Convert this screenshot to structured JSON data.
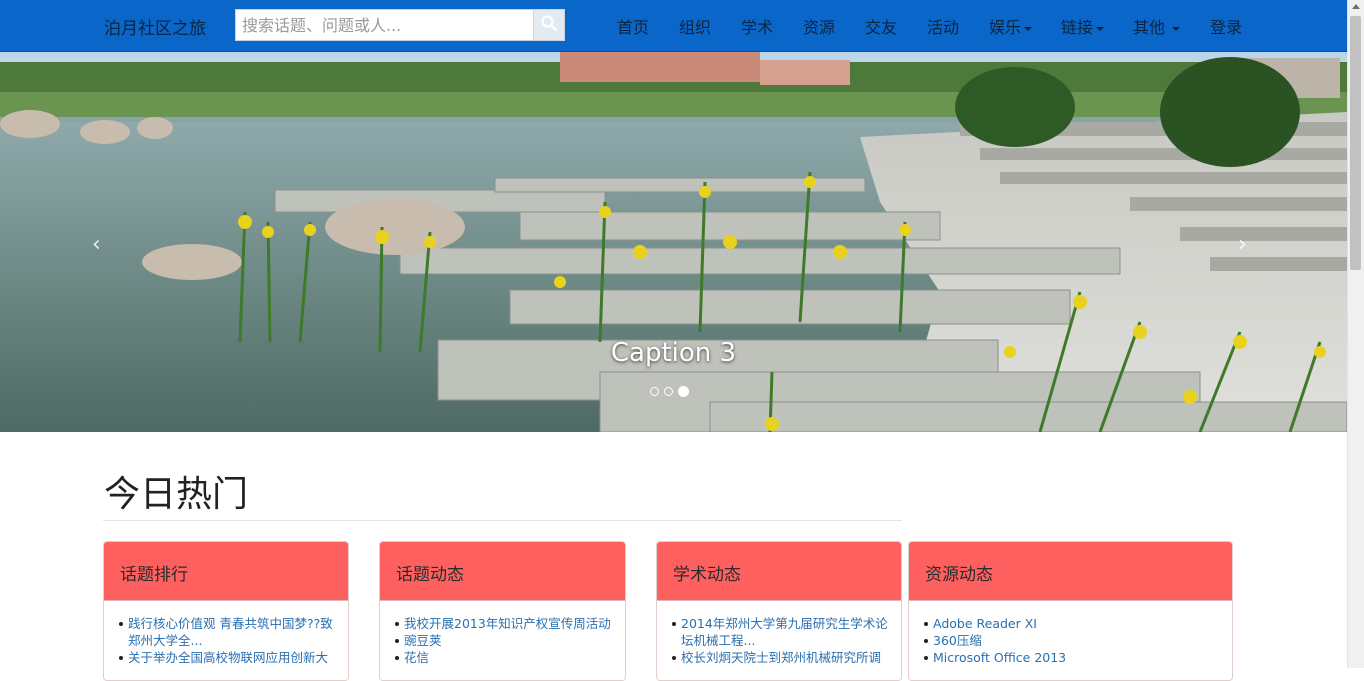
{
  "navbar": {
    "brand": "泊月社区之旅",
    "search_placeholder": "搜索话题、问题或人...",
    "items": [
      {
        "label": "首页",
        "dropdown": false
      },
      {
        "label": "组织",
        "dropdown": false
      },
      {
        "label": "学术",
        "dropdown": false
      },
      {
        "label": "资源",
        "dropdown": false
      },
      {
        "label": "交友",
        "dropdown": false
      },
      {
        "label": "活动",
        "dropdown": false
      },
      {
        "label": "娱乐",
        "dropdown": true
      },
      {
        "label": "链接",
        "dropdown": true
      },
      {
        "label": "其他",
        "dropdown": true
      },
      {
        "label": "登录",
        "dropdown": false
      }
    ]
  },
  "carousel": {
    "caption": "Caption 3",
    "prev_icon": "‹",
    "next_icon": "›",
    "slide_count": 3,
    "active_index": 3
  },
  "main": {
    "section_title": "今日热门",
    "panels": [
      {
        "title": "话题排行",
        "items": [
          {
            "text": "践行核心价值观 青春共筑中国梦??致",
            "continued": false
          },
          {
            "text": "郑州大学全...",
            "continued": true
          },
          {
            "text": "关于举办全国高校物联网应用创新大",
            "continued": false
          }
        ]
      },
      {
        "title": "话题动态",
        "items": [
          {
            "text": "我校开展2013年知识产权宣传周活动",
            "continued": false
          },
          {
            "text": "豌豆荚",
            "continued": false
          },
          {
            "text": "花信",
            "continued": false
          }
        ]
      },
      {
        "title": "学术动态",
        "items": [
          {
            "text": "2014年郑州大学第九届研究生学术论",
            "continued": false
          },
          {
            "text": "坛机械工程...",
            "continued": true
          },
          {
            "text": "校长刘炯天院士到郑州机械研究所调",
            "continued": false
          }
        ]
      },
      {
        "title": "资源动态",
        "items": [
          {
            "text": "Adobe Reader XI",
            "continued": false
          },
          {
            "text": "360压缩",
            "continued": false
          },
          {
            "text": "Microsoft Office 2013",
            "continued": false
          }
        ]
      }
    ]
  },
  "colors": {
    "navbar_bg": "#0a66c8",
    "panel_header_bg": "#fd605f",
    "link": "#2a6fb0"
  },
  "icons": {
    "search": "search-icon",
    "prev": "chevron-left-icon",
    "next": "chevron-right-icon"
  }
}
